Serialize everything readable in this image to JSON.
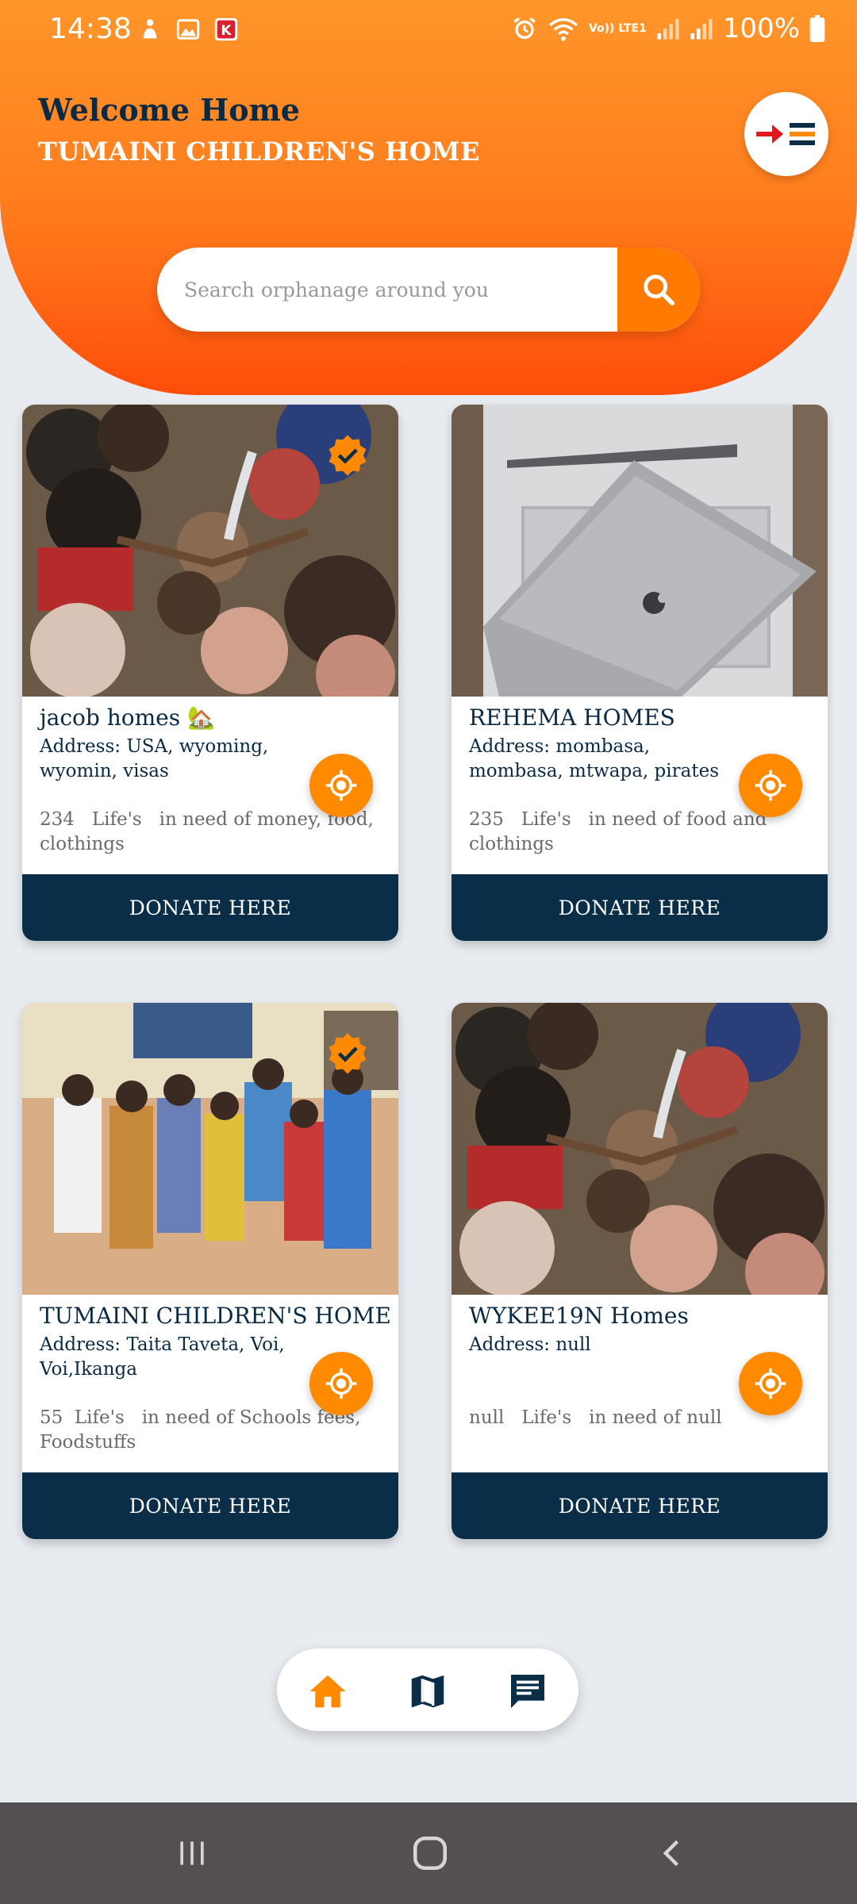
{
  "status_bar": {
    "time": "14:38",
    "battery": "100%",
    "network": "Vo)) LTE1"
  },
  "header": {
    "welcome": "Welcome Home",
    "org_name": "TUMAINI CHILDREN'S HOME"
  },
  "search": {
    "placeholder": "Search orphanage around you",
    "value": ""
  },
  "cards": [
    {
      "title": "jacob homes 🏡",
      "address": "Address: USA, wyoming, wyomin, visas",
      "needs": "234   Life's   in need of  money, food, clothings",
      "verified": true,
      "photo": "children-hands-circle",
      "donate_label": "DONATE HERE"
    },
    {
      "title": "REHEMA HOMES",
      "address": "Address: mombasa, mombasa, mtwapa, pirates",
      "needs": "235   Life's   in need of  food and clothings",
      "verified": false,
      "photo": "laptop-on-box",
      "donate_label": "DONATE HERE"
    },
    {
      "title": "TUMAINI CHILDREN'S HOME",
      "address": "Address: Taita Taveta, Voi, Voi,Ikanga",
      "needs": "55  Life's   in need of  Schools fees, Foodstuffs",
      "verified": true,
      "photo": "children-group",
      "donate_label": "DONATE HERE"
    },
    {
      "title": "WYKEE19N Homes",
      "address": "Address: null",
      "needs": "null   Life's   in need of  null",
      "verified": false,
      "photo": "children-hands-circle",
      "donate_label": "DONATE HERE"
    }
  ],
  "bottom_nav": {
    "items": [
      "home-icon",
      "map-icon",
      "chat-icon"
    ],
    "active": "home-icon"
  },
  "colors": {
    "accent": "#ff7a00",
    "navy": "#0b2e48",
    "header_top": "#ff962a",
    "header_bottom": "#fe4e0a",
    "background": "#e8ebef"
  }
}
